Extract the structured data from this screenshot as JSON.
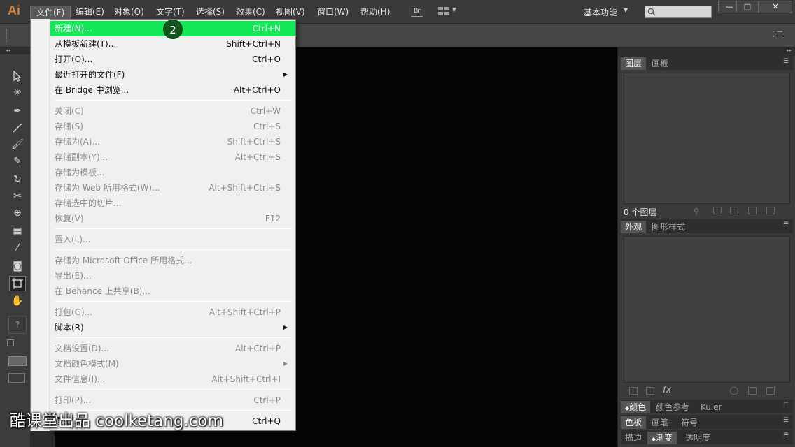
{
  "app": {
    "logo": "Ai"
  },
  "menubar": {
    "items": [
      "文件(F)",
      "编辑(E)",
      "对象(O)",
      "文字(T)",
      "选择(S)",
      "效果(C)",
      "视图(V)",
      "窗口(W)",
      "帮助(H)"
    ],
    "active_item": "文件(F)",
    "bridge_button": "Br",
    "workspace": "基本功能",
    "search_placeholder": ""
  },
  "window_controls": {
    "minimize": "—",
    "maximize": "□",
    "close": "✕"
  },
  "file_menu": {
    "groups": [
      [
        {
          "label": "新建(N)...",
          "shortcut": "Ctrl+N",
          "enabled": true,
          "highlighted": true
        },
        {
          "label": "从模板新建(T)...",
          "shortcut": "Shift+Ctrl+N",
          "enabled": true
        },
        {
          "label": "打开(O)...",
          "shortcut": "Ctrl+O",
          "enabled": true
        },
        {
          "label": "最近打开的文件(F)",
          "shortcut": "",
          "enabled": true,
          "submenu": true
        },
        {
          "label": "在 Bridge 中浏览...",
          "shortcut": "Alt+Ctrl+O",
          "enabled": true
        }
      ],
      [
        {
          "label": "关闭(C)",
          "shortcut": "Ctrl+W",
          "enabled": false
        },
        {
          "label": "存储(S)",
          "shortcut": "Ctrl+S",
          "enabled": false
        },
        {
          "label": "存储为(A)...",
          "shortcut": "Shift+Ctrl+S",
          "enabled": false
        },
        {
          "label": "存储副本(Y)...",
          "shortcut": "Alt+Ctrl+S",
          "enabled": false
        },
        {
          "label": "存储为模板...",
          "shortcut": "",
          "enabled": false
        },
        {
          "label": "存储为 Web 所用格式(W)...",
          "shortcut": "Alt+Shift+Ctrl+S",
          "enabled": false
        },
        {
          "label": "存储选中的切片...",
          "shortcut": "",
          "enabled": false
        },
        {
          "label": "恢复(V)",
          "shortcut": "F12",
          "enabled": false
        }
      ],
      [
        {
          "label": "置入(L)...",
          "shortcut": "",
          "enabled": false
        }
      ],
      [
        {
          "label": "存储为 Microsoft Office 所用格式...",
          "shortcut": "",
          "enabled": false
        },
        {
          "label": "导出(E)...",
          "shortcut": "",
          "enabled": false
        },
        {
          "label": "在 Behance 上共享(B)...",
          "shortcut": "",
          "enabled": false
        }
      ],
      [
        {
          "label": "打包(G)...",
          "shortcut": "Alt+Shift+Ctrl+P",
          "enabled": false
        },
        {
          "label": "脚本(R)",
          "shortcut": "",
          "enabled": true,
          "submenu": true
        }
      ],
      [
        {
          "label": "文档设置(D)...",
          "shortcut": "Alt+Ctrl+P",
          "enabled": false
        },
        {
          "label": "文档颜色模式(M)",
          "shortcut": "",
          "enabled": false,
          "submenu": true
        },
        {
          "label": "文件信息(I)...",
          "shortcut": "Alt+Shift+Ctrl+I",
          "enabled": false
        }
      ],
      [
        {
          "label": "打印(P)...",
          "shortcut": "Ctrl+P",
          "enabled": false
        }
      ],
      [
        {
          "label": "退出(X)",
          "shortcut": "Ctrl+Q",
          "enabled": true
        }
      ]
    ]
  },
  "step_badge": "2",
  "panels": {
    "layers": {
      "tabs": [
        "图层",
        "画板"
      ],
      "count_text": "0 个图层"
    },
    "appearance": {
      "tabs": [
        "外观",
        "图形样式"
      ],
      "fx": "fx"
    },
    "color": {
      "tabs": [
        "颜色",
        "颜色参考",
        "Kuler"
      ]
    },
    "swatches": {
      "tabs": [
        "色板",
        "画笔",
        "符号"
      ]
    },
    "stroke": {
      "tabs": [
        "描边",
        "渐变",
        "透明度"
      ]
    }
  },
  "tools": [
    "selection-tool",
    "magic-wand-tool",
    "pen-tool",
    "line-tool",
    "paintbrush-tool",
    "shaper-tool",
    "rotate-tool",
    "warp-tool",
    "shape-builder-tool",
    "mesh-tool",
    "eyedropper-tool",
    "symbol-sprayer-tool",
    "artboard-tool",
    "hand-tool"
  ],
  "tool_help": "?",
  "watermark": "酷课堂出品 coolketang.com",
  "colors": {
    "highlight": "#14e858",
    "badge": "#12561e",
    "logo": "#d48437"
  }
}
